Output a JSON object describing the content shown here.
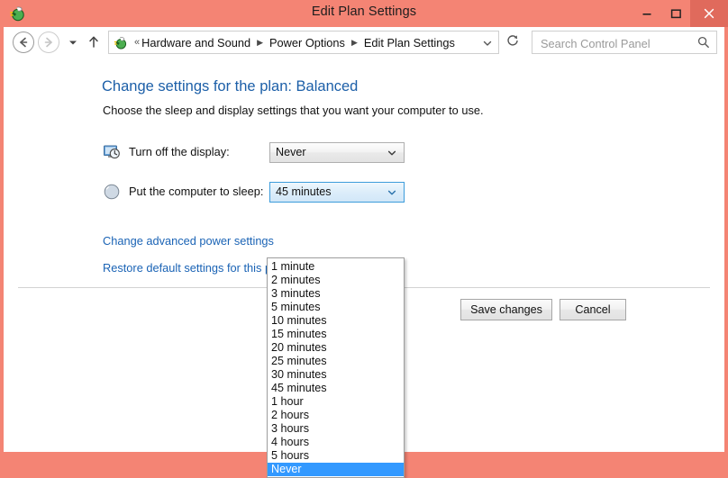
{
  "window": {
    "title": "Edit Plan Settings",
    "app_icon": "power-plug-icon",
    "frame_color": "#f48474",
    "close_button_color": "#e06a5c",
    "controls": {
      "minimize": "–",
      "maximize": "❑",
      "close": "✕"
    }
  },
  "nav": {
    "back_icon": "back-arrow-icon",
    "forward_icon": "forward-arrow-icon",
    "history_icon": "chevron-down-icon",
    "up_icon": "up-arrow-icon",
    "breadcrumb_icon": "power-plug-icon",
    "breadcrumb_prefix": "«",
    "breadcrumb": [
      {
        "label": "Hardware and Sound"
      },
      {
        "label": "Power Options"
      },
      {
        "label": "Edit Plan Settings"
      }
    ],
    "breadcrumb_dropdown_icon": "chevron-down-icon",
    "refresh_icon": "refresh-icon",
    "search": {
      "placeholder": "Search Control Panel",
      "value": "",
      "icon": "search-icon"
    }
  },
  "main": {
    "heading": "Change settings for the plan: Balanced",
    "heading_color": "#1c5fa8",
    "subheading": "Choose the sleep and display settings that you want your computer to use.",
    "settings": [
      {
        "id": "display",
        "icon": "monitor-clock-icon",
        "label": "Turn off the display:",
        "value": "Never",
        "focused": false
      },
      {
        "id": "sleep",
        "icon": "moon-sleep-icon",
        "label": "Put the computer to sleep:",
        "value": "45 minutes",
        "focused": true
      }
    ],
    "links": [
      {
        "label": "Change advanced power settings"
      },
      {
        "label": "Restore default settings for this plan"
      }
    ],
    "buttons": {
      "save": "Save changes",
      "cancel": "Cancel"
    }
  },
  "dropdown": {
    "open": true,
    "owner": "sleep",
    "highlight_color": "#3399ff",
    "selected_value": "Never",
    "options": [
      "1 minute",
      "2 minutes",
      "3 minutes",
      "5 minutes",
      "10 minutes",
      "15 minutes",
      "20 minutes",
      "25 minutes",
      "30 minutes",
      "45 minutes",
      "1 hour",
      "2 hours",
      "3 hours",
      "4 hours",
      "5 hours",
      "Never"
    ]
  }
}
